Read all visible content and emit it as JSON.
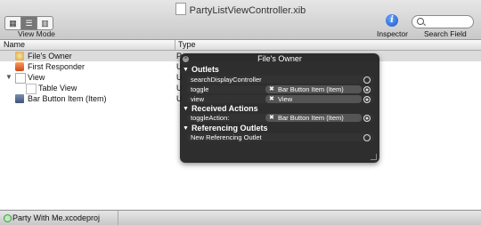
{
  "window": {
    "title": "PartyListViewController.xib"
  },
  "toolbar": {
    "view_mode_label": "View Mode",
    "inspector_label": "Inspector",
    "search_label": "Search Field"
  },
  "table": {
    "columns": [
      "Name",
      "Type"
    ],
    "rows": [
      {
        "name": "File's Owner",
        "type": "P"
      },
      {
        "name": "First Responder",
        "type": "U"
      },
      {
        "name": "View",
        "type": "U"
      },
      {
        "name": "Table View",
        "type": "U"
      },
      {
        "name": "Bar Button Item (Item)",
        "type": "U"
      }
    ]
  },
  "hud": {
    "title": "File's Owner",
    "outlets_header": "Outlets",
    "outlets": [
      {
        "name": "searchDisplayController",
        "target": ""
      },
      {
        "name": "toggle",
        "target": "Bar Button Item (Item)"
      },
      {
        "name": "view",
        "target": "View"
      }
    ],
    "received_header": "Received Actions",
    "received": [
      {
        "name": "toggleAction:",
        "target": "Bar Button Item (Item)"
      }
    ],
    "referencing_header": "Referencing Outlets",
    "referencing": [
      {
        "name": "New Referencing Outlet",
        "target": ""
      }
    ]
  },
  "status": {
    "project": "Party With Me.xcodeproj"
  },
  "colors": {
    "hud_bg": "#1e1e1e",
    "selection": "#dcdcdc",
    "info_blue": "#1a54c8"
  }
}
